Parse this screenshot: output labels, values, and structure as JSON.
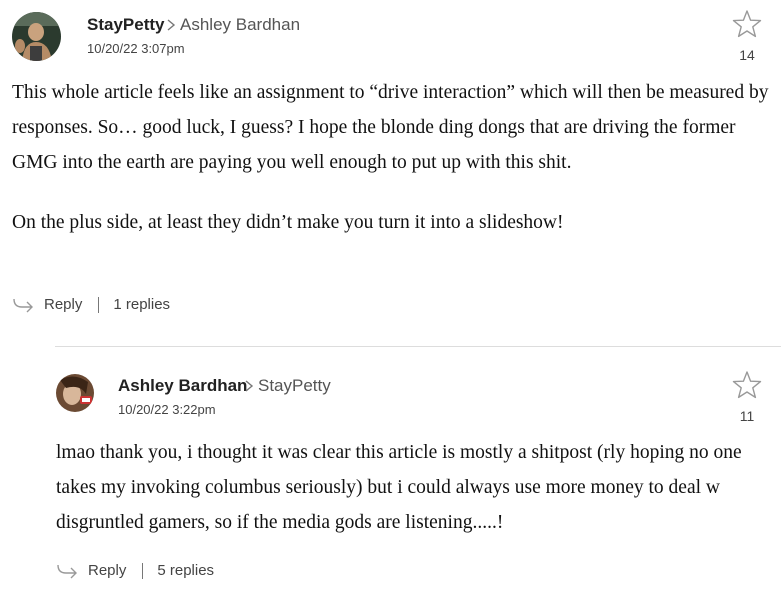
{
  "comments": [
    {
      "author": "StayPetty",
      "reply_to": "Ashley Bardhan",
      "timestamp": "10/20/22 3:07pm",
      "stars": "14",
      "paragraphs": [
        "This whole article feels like an assignment to “drive interaction” which will then be measured by responses. So… good luck, I guess? I hope the blonde ding dongs that are driving the former GMG into the earth are paying you well enough to put up with this shit.",
        "On the plus side, at least they didn’t make you turn it into a slideshow!"
      ],
      "reply_label": "Reply",
      "replies_label": "1 replies"
    },
    {
      "author": "Ashley Bardhan",
      "reply_to": "StayPetty",
      "timestamp": "10/20/22 3:22pm",
      "stars": "11",
      "paragraphs": [
        "lmao thank you, i thought it was clear this article is mostly a shitpost (rly hoping no one takes my invoking columbus seriously) but i could always use more money to deal w disgruntled gamers, so if the media gods are listening.....!"
      ],
      "reply_label": "Reply",
      "replies_label": "5 replies"
    }
  ],
  "icons": {
    "star": "star-outline-icon",
    "reply": "reply-arrow-icon",
    "chevron": "chevron-right-icon"
  },
  "colors": {
    "text": "#111111",
    "meta": "#444444",
    "icon": "#999999"
  }
}
